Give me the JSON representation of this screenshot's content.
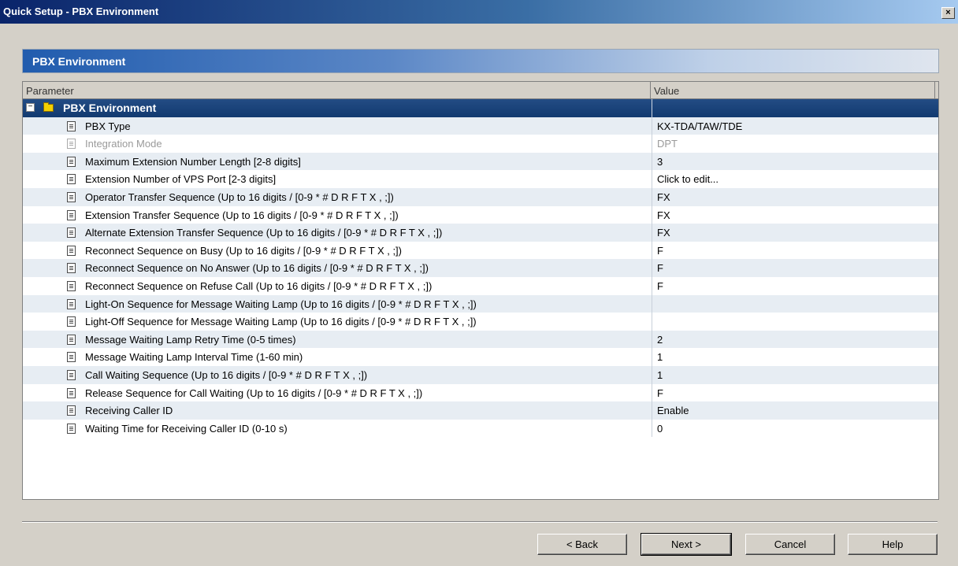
{
  "window": {
    "title": "Quick Setup - PBX Environment",
    "close_label": "×"
  },
  "panel": {
    "header": "PBX Environment"
  },
  "grid": {
    "columns": {
      "parameter": "Parameter",
      "value": "Value"
    },
    "group": {
      "label": "PBX Environment",
      "toggle": "−"
    },
    "rows": [
      {
        "param": "PBX Type",
        "value": "KX-TDA/TAW/TDE"
      },
      {
        "param": "Integration Mode",
        "value": "DPT"
      },
      {
        "param": "Maximum Extension Number Length [2-8 digits]",
        "value": "3"
      },
      {
        "param": "Extension Number of VPS Port [2-3 digits]",
        "value": "Click to edit..."
      },
      {
        "param": "Operator Transfer Sequence (Up to 16 digits / [0-9 * # D R F T X , ;])",
        "value": "FX"
      },
      {
        "param": "Extension Transfer Sequence (Up to 16 digits / [0-9 * # D R F T X , ;])",
        "value": "FX"
      },
      {
        "param": "Alternate Extension Transfer Sequence (Up to 16 digits / [0-9 * # D R F T X , ;])",
        "value": "FX"
      },
      {
        "param": "Reconnect Sequence on Busy (Up to 16 digits / [0-9 * # D R F T X , ;])",
        "value": "F"
      },
      {
        "param": "Reconnect Sequence on No Answer (Up to 16 digits / [0-9 * # D R F T X , ;])",
        "value": "F"
      },
      {
        "param": "Reconnect Sequence on Refuse Call (Up to 16 digits / [0-9 * # D R F T X , ;])",
        "value": "F"
      },
      {
        "param": "Light-On Sequence for Message Waiting Lamp (Up to 16 digits / [0-9 * # D R F T X , ;])",
        "value": ""
      },
      {
        "param": "Light-Off Sequence for Message Waiting Lamp (Up to 16 digits / [0-9 * # D R F T X , ;])",
        "value": ""
      },
      {
        "param": "Message Waiting Lamp Retry Time (0-5 times)",
        "value": "2"
      },
      {
        "param": "Message Waiting Lamp Interval Time (1-60 min)",
        "value": "1"
      },
      {
        "param": "Call Waiting Sequence (Up to 16 digits / [0-9 * # D R F T X , ;])",
        "value": "1"
      },
      {
        "param": "Release Sequence for Call Waiting (Up to 16 digits / [0-9 * # D R F T X , ;])",
        "value": "F"
      },
      {
        "param": "Receiving Caller ID",
        "value": "Enable"
      },
      {
        "param": "Waiting Time for Receiving Caller ID (0-10 s)",
        "value": "0"
      }
    ]
  },
  "buttons": {
    "back": "< Back",
    "next": "Next >",
    "cancel": "Cancel",
    "help": "Help"
  }
}
